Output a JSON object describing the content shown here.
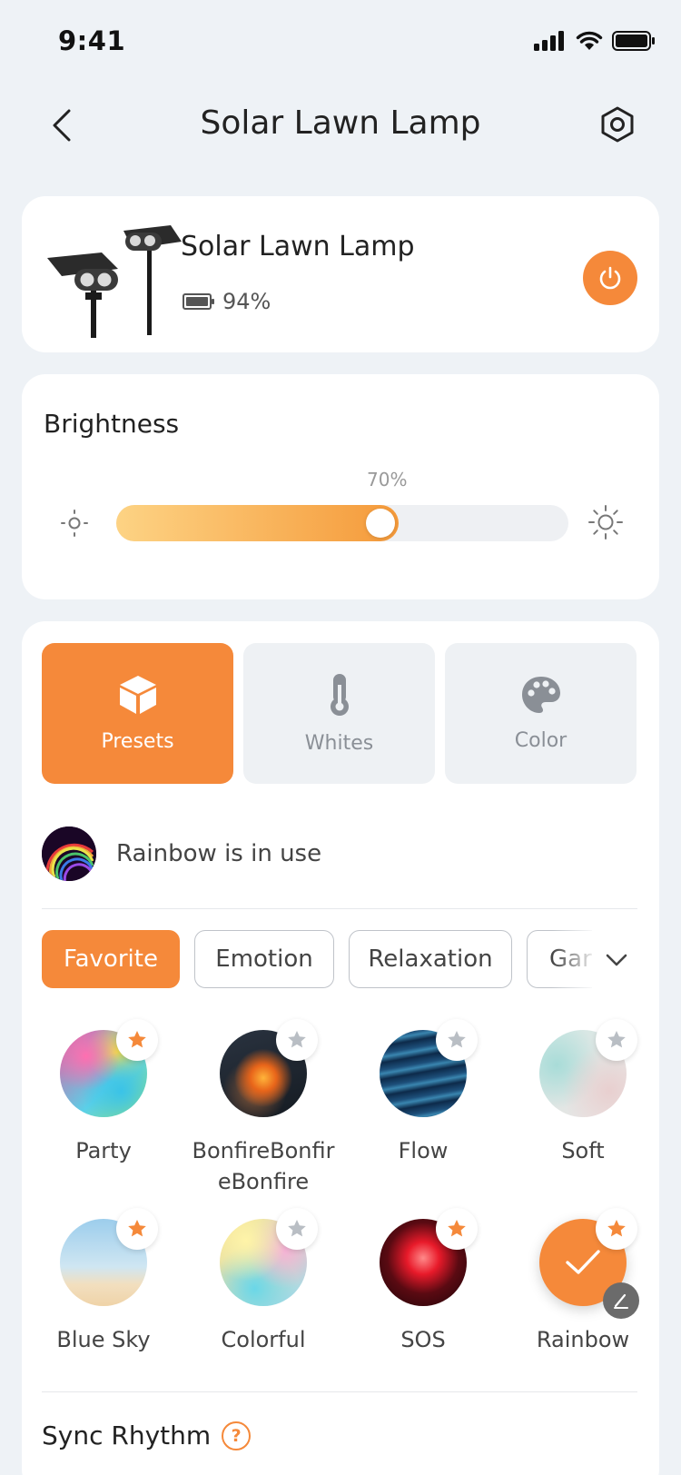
{
  "status_bar": {
    "time": "9:41"
  },
  "header": {
    "title": "Solar Lawn Lamp"
  },
  "device": {
    "name": "Solar Lawn Lamp",
    "battery": "94%",
    "power_on": true
  },
  "brightness": {
    "title": "Brightness",
    "value_label": "70%",
    "value": 0.7
  },
  "modes": [
    {
      "label": "Presets",
      "icon": "cube-icon",
      "active": true
    },
    {
      "label": "Whites",
      "icon": "thermometer-icon",
      "active": false
    },
    {
      "label": "Color",
      "icon": "palette-icon",
      "active": false
    }
  ],
  "in_use": {
    "text": "Rainbow is in use"
  },
  "categories": [
    "Favorite",
    "Emotion",
    "Relaxation",
    "Gar"
  ],
  "presets": [
    {
      "label": "Party",
      "favorite": true
    },
    {
      "label": "BonfireBonfireBonfire",
      "favorite": false
    },
    {
      "label": "Flow",
      "favorite": false
    },
    {
      "label": "Soft",
      "favorite": false
    },
    {
      "label": "Blue Sky",
      "favorite": true
    },
    {
      "label": "Colorful",
      "favorite": false
    },
    {
      "label": "SOS",
      "favorite": true
    },
    {
      "label": "Rainbow",
      "favorite": true,
      "selected": true
    }
  ],
  "sync": {
    "title": "Sync Rhythm",
    "help": "?"
  },
  "colors": {
    "accent": "#f5893a",
    "star_on": "#f5893a",
    "star_off": "#b9bec4"
  }
}
